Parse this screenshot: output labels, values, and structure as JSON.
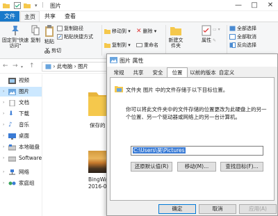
{
  "titlebar": {
    "title": "图片",
    "controls": {
      "minimize": "—",
      "maximize": "□",
      "close": "✕"
    }
  },
  "ribbon_tabs": {
    "file": "文件",
    "home": "主页",
    "share": "共享",
    "view": "查看"
  },
  "ribbon": {
    "pin_quick_access": "固定到\"快速访问\"",
    "copy": "复制",
    "paste": "粘贴",
    "copy_path": "复制路径",
    "paste_shortcut": "粘贴快捷方式",
    "cut": "剪切",
    "move_to": "移动到",
    "copy_to": "复制到",
    "delete": "删除",
    "rename": "重命名",
    "new_folder": "新建文件夹",
    "properties": "属性",
    "select_all": "全部选择",
    "select_none": "全部取消",
    "invert_selection": "反向选择"
  },
  "addressbar": {
    "back": "←",
    "forward": "→",
    "up": "↑",
    "path": "› 此电脑 › 图片"
  },
  "navpane": {
    "items": [
      {
        "label": "视频",
        "icon": "video-folder-icon"
      },
      {
        "label": "图片",
        "icon": "pictures-folder-icon",
        "selected": true
      },
      {
        "label": "文档",
        "icon": "documents-folder-icon"
      },
      {
        "label": "下载",
        "icon": "downloads-folder-icon"
      },
      {
        "label": "音乐",
        "icon": "music-folder-icon"
      },
      {
        "label": "桌面",
        "icon": "desktop-folder-icon"
      },
      {
        "label": "本地磁盘 (C:)",
        "icon": "drive-icon"
      },
      {
        "label": "Softwares (D:)",
        "icon": "drive-icon"
      },
      {
        "label": "网络",
        "icon": "network-icon"
      },
      {
        "label": "家庭组",
        "icon": "homegroup-icon"
      }
    ]
  },
  "files": {
    "folder_label": "保存的",
    "image_label_1": "BingWa",
    "image_label_2": "2016-0"
  },
  "dialog": {
    "title": "图片 属性",
    "tabs": [
      "常规",
      "共享",
      "安全",
      "位置",
      "以前的版本",
      "自定义"
    ],
    "active_tab": "位置",
    "folder_description": "文件夹 图片 中的文件存储于以下目标位置。",
    "help_text": "你可以将此文件夹中的文件存储的位置更改为此硬盘上的另一个位置、另一个驱动器或网络上的另一台计算机。",
    "path_value": "C:\\Users\\昊\\Pictures",
    "buttons": {
      "restore_default": "还原默认值(R)",
      "move": "移动(M)...",
      "find_target": "查找目标(F)..."
    },
    "footer": {
      "ok": "确定",
      "cancel": "取消",
      "apply": "应用(A)"
    }
  },
  "colors": {
    "accent": "#1979ca",
    "selection": "#cce8ff",
    "text_selection": "#3a7bd5",
    "folder_yellow": "#f5c84c"
  }
}
